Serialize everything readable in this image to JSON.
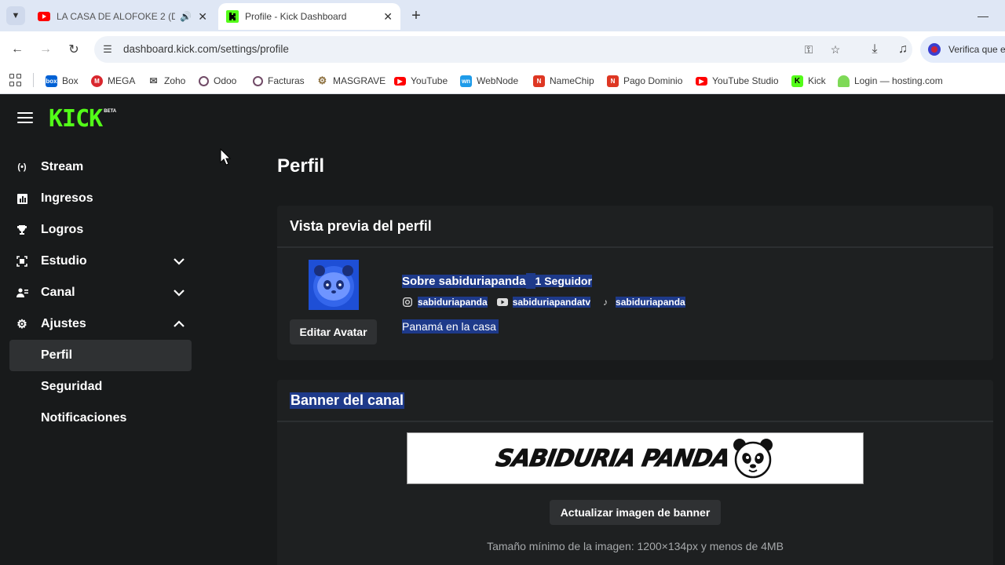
{
  "browser": {
    "tabs": [
      {
        "title": "LA CASA DE ALOFOKE 2 (DI",
        "favicon": "youtube-icon",
        "playing_audio": true
      },
      {
        "title": "Profile - Kick Dashboard",
        "favicon": "kick-icon",
        "active": true
      }
    ],
    "url": "dashboard.kick.com/settings/profile",
    "profile_chip": "Verifica que e",
    "bookmarks": [
      {
        "label": "Box",
        "icon": "box-icon",
        "color": "#0061d5"
      },
      {
        "label": "MEGA",
        "icon": "mega-icon",
        "color": "#d9272e"
      },
      {
        "label": "Zoho",
        "icon": "zoho-icon",
        "color": "#555555"
      },
      {
        "label": "Odoo",
        "icon": "odoo-icon",
        "color": "#714b67"
      },
      {
        "label": "Facturas",
        "icon": "odoo-icon",
        "color": "#714b67"
      },
      {
        "label": "MASGRAVE",
        "icon": "gear-icon",
        "color": "#8a6d3b"
      },
      {
        "label": "YouTube",
        "icon": "youtube-icon",
        "color": "#ff0000"
      },
      {
        "label": "WebNode",
        "icon": "webnode-icon",
        "color": "#1e9be9"
      },
      {
        "label": "NameChip",
        "icon": "namecheap-icon",
        "color": "#de3723"
      },
      {
        "label": "Pago Dominio",
        "icon": "namecheap-icon",
        "color": "#de3723"
      },
      {
        "label": "YouTube Studio",
        "icon": "youtube-icon",
        "color": "#ff0000"
      },
      {
        "label": "Kick",
        "icon": "kick-icon",
        "color": "#53fc18"
      },
      {
        "label": "Login — hosting.com",
        "icon": "hosting-icon",
        "color": "#7ed957"
      }
    ]
  },
  "app": {
    "logo_text": "KICK",
    "logo_badge": "BETA",
    "nav": {
      "stream": "Stream",
      "ingresos": "Ingresos",
      "logros": "Logros",
      "estudio": "Estudio",
      "canal": "Canal",
      "ajustes": "Ajustes",
      "perfil": "Perfil",
      "seguridad": "Seguridad",
      "notificaciones": "Notificaciones"
    },
    "page_title": "Perfil",
    "preview": {
      "title": "Vista previa del perfil",
      "edit_avatar": "Editar Avatar",
      "about": "Sobre sabiduriapanda",
      "followers": "1 Seguidor",
      "instagram": "sabiduriapanda",
      "youtube": "sabiduriapandatv",
      "tiktok": "sabiduriapanda",
      "bio": "Panamá en la casa"
    },
    "banner": {
      "title": "Banner del canal",
      "image_text": "SABIDURIA PANDA",
      "update_button": "Actualizar imagen de banner",
      "note": "Tamaño mínimo de la imagen: 1200×134px y menos de 4MB"
    },
    "colors": {
      "brand": "#53fc18",
      "background": "#181a1b",
      "card": "#1e2021",
      "selection": "#1e3a8a"
    }
  }
}
